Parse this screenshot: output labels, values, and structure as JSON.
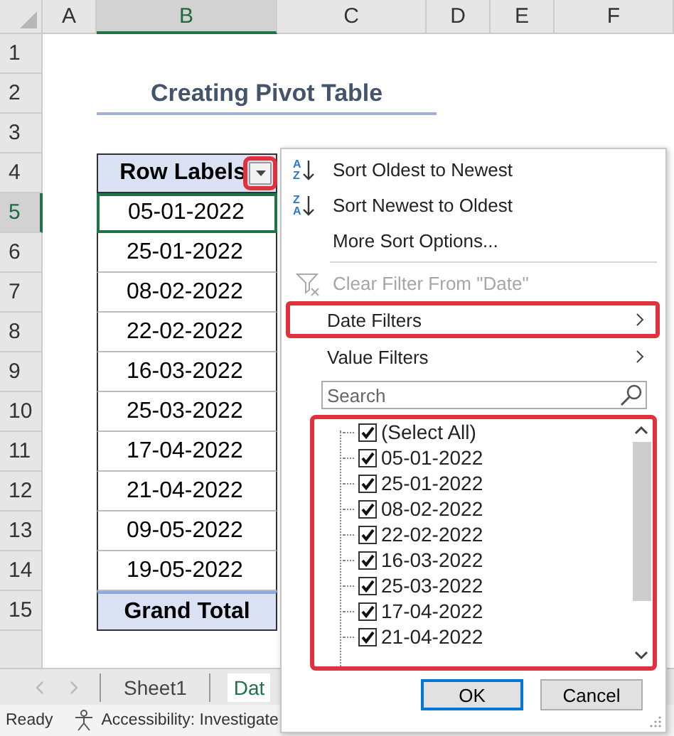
{
  "columns": [
    {
      "label": "A",
      "selected": false
    },
    {
      "label": "B",
      "selected": true
    },
    {
      "label": "C",
      "selected": false
    },
    {
      "label": "D",
      "selected": false
    },
    {
      "label": "E",
      "selected": false
    },
    {
      "label": "F",
      "selected": false
    }
  ],
  "rows": [
    {
      "label": "1",
      "selected": false
    },
    {
      "label": "2",
      "selected": false
    },
    {
      "label": "3",
      "selected": false
    },
    {
      "label": "4",
      "selected": false
    },
    {
      "label": "5",
      "selected": true
    },
    {
      "label": "6",
      "selected": false
    },
    {
      "label": "7",
      "selected": false
    },
    {
      "label": "8",
      "selected": false
    },
    {
      "label": "9",
      "selected": false
    },
    {
      "label": "10",
      "selected": false
    },
    {
      "label": "11",
      "selected": false
    },
    {
      "label": "12",
      "selected": false
    },
    {
      "label": "13",
      "selected": false
    },
    {
      "label": "14",
      "selected": false
    },
    {
      "label": "15",
      "selected": false
    }
  ],
  "title": "Creating Pivot Table",
  "pivot": {
    "header": "Row Labels",
    "filter_highlighted": true,
    "total": "Grand Total",
    "items": [
      {
        "label": "05-01-2022",
        "selected": true
      },
      {
        "label": "25-01-2022",
        "selected": false
      },
      {
        "label": "08-02-2022",
        "selected": false
      },
      {
        "label": "22-02-2022",
        "selected": false
      },
      {
        "label": "16-03-2022",
        "selected": false
      },
      {
        "label": "25-03-2022",
        "selected": false
      },
      {
        "label": "17-04-2022",
        "selected": false
      },
      {
        "label": "21-04-2022",
        "selected": false
      },
      {
        "label": "09-05-2022",
        "selected": false
      },
      {
        "label": "19-05-2022",
        "selected": false
      }
    ]
  },
  "filter_menu": {
    "items": [
      {
        "kind": "sort",
        "icon_top": "A",
        "icon_bottom": "Z",
        "label": "Sort Oldest to Newest",
        "disabled": false
      },
      {
        "kind": "sort",
        "icon_top": "Z",
        "icon_bottom": "A",
        "label": "Sort Newest to Oldest",
        "disabled": false
      },
      {
        "kind": "plain",
        "label": "More Sort Options...",
        "disabled": false
      },
      {
        "kind": "separator"
      },
      {
        "kind": "clear",
        "label": "Clear Filter From \"Date\"",
        "disabled": true
      },
      {
        "kind": "submenu",
        "label": "Date Filters",
        "disabled": false,
        "highlighted": true
      },
      {
        "kind": "submenu",
        "label": "Value Filters",
        "disabled": false,
        "highlighted": false
      }
    ],
    "search": {
      "placeholder": "Search"
    },
    "list_highlighted": true,
    "checklist": [
      {
        "label": "(Select All)",
        "checked": true
      },
      {
        "label": "05-01-2022",
        "checked": true
      },
      {
        "label": "25-01-2022",
        "checked": true
      },
      {
        "label": "08-02-2022",
        "checked": true
      },
      {
        "label": "22-02-2022",
        "checked": true
      },
      {
        "label": "16-03-2022",
        "checked": true
      },
      {
        "label": "25-03-2022",
        "checked": true
      },
      {
        "label": "17-04-2022",
        "checked": true
      },
      {
        "label": "21-04-2022",
        "checked": true
      }
    ],
    "buttons": [
      {
        "label": "OK",
        "default": true
      },
      {
        "label": "Cancel",
        "default": false
      }
    ]
  },
  "sheet_tabs": [
    {
      "label": "Sheet1",
      "selected": false
    },
    {
      "label": "Dat",
      "selected": true
    }
  ],
  "status_bar": {
    "mode": "Ready",
    "accessibility": "Accessibility: Investigate"
  }
}
